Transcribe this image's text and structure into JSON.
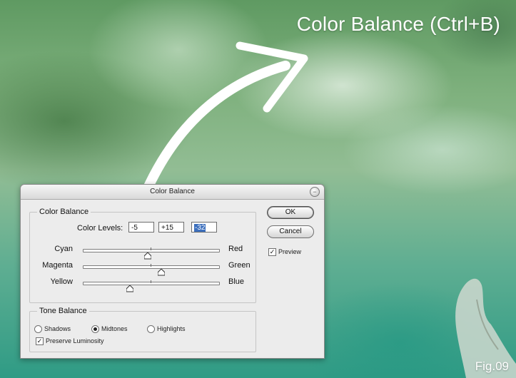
{
  "figure": {
    "title": "Color Balance (Ctrl+B)",
    "label": "Fig.09"
  },
  "dialog": {
    "title": "Color Balance",
    "color_balance_group": {
      "legend": "Color Balance",
      "levels_label": "Color Levels:",
      "levels": [
        "-5",
        "+15",
        "-32"
      ],
      "sliders": [
        {
          "left": "Cyan",
          "right": "Red",
          "value": -5
        },
        {
          "left": "Magenta",
          "right": "Green",
          "value": 15
        },
        {
          "left": "Yellow",
          "right": "Blue",
          "value": -32
        }
      ],
      "slider_range": [
        -100,
        100
      ]
    },
    "tone_balance_group": {
      "legend": "Tone Balance",
      "options": [
        "Shadows",
        "Midtones",
        "Highlights"
      ],
      "selected": "Midtones",
      "preserve_luminosity": "Preserve Luminosity",
      "preserve_checked": true
    },
    "buttons": {
      "ok": "OK",
      "cancel": "Cancel"
    },
    "preview": {
      "label": "Preview",
      "checked": true
    }
  },
  "colors": {
    "selection": "#3c6fbd",
    "sky_green": "#7fb17e",
    "teal": "#2f9b85"
  }
}
